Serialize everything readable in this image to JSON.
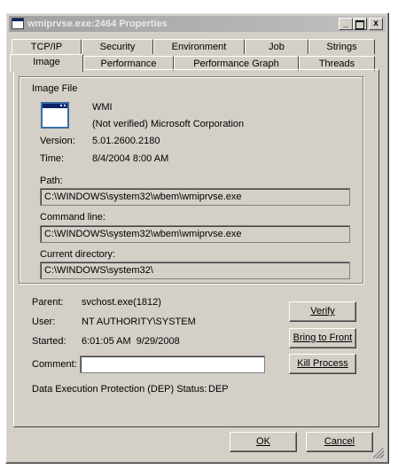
{
  "window": {
    "title": "wmiprvse.exe:2464 Properties",
    "buttons": {
      "help": "?",
      "close": "x",
      "minimize": "_"
    }
  },
  "tabs": {
    "row1": [
      "TCP/IP",
      "Security",
      "Environment",
      "Job",
      "Strings"
    ],
    "row2": [
      "Image",
      "Performance",
      "Performance Graph",
      "Threads"
    ],
    "selected": "Image"
  },
  "image_file": {
    "group_title": "Image File",
    "description": "WMI",
    "company": "(Not verified) Microsoft Corporation",
    "version_label": "Version:",
    "version": "5.01.2600.2180",
    "time_label": "Time:",
    "time": "8/4/2004 8:00 AM",
    "path_label": "Path:",
    "path": "C:\\WINDOWS\\system32\\wbem\\wmiprvse.exe",
    "command_line_label": "Command line:",
    "command_line": "C:\\WINDOWS\\system32\\wbem\\wmiprvse.exe",
    "current_dir_label": "Current directory:",
    "current_dir": "C:\\WINDOWS\\system32\\"
  },
  "process": {
    "parent_label": "Parent:",
    "parent": "svchost.exe(1812)",
    "user_label": "User:",
    "user": "NT AUTHORITY\\SYSTEM",
    "started_label": "Started:",
    "started": "6:01:05 AM  9/29/2008",
    "comment_label": "Comment:",
    "comment": "",
    "dep_label": "Data Execution Protection (DEP) Status:",
    "dep": "DEP"
  },
  "actions": {
    "verify": "Verify",
    "bring_to_front": "Bring to Front",
    "kill_process": "Kill Process",
    "ok": "OK",
    "cancel": "Cancel"
  }
}
